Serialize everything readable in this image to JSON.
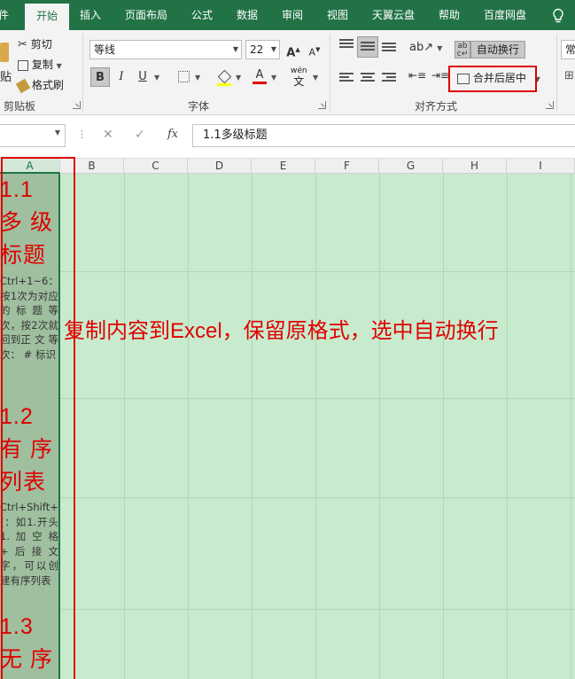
{
  "ribbon_tabs": [
    "件",
    "开始",
    "插入",
    "页面布局",
    "公式",
    "数据",
    "审阅",
    "视图",
    "天翼云盘",
    "帮助",
    "百度网盘"
  ],
  "clipboard": {
    "paste_label": "贴",
    "cut_label": "剪切",
    "copy_label": "复制",
    "format_painter_label": "格式刷",
    "group_label": "剪贴板"
  },
  "font": {
    "name": "等线",
    "size": "22",
    "grow_label": "A",
    "shrink_label": "A",
    "bold_label": "B",
    "italic_label": "I",
    "underline_label": "U",
    "font_color": "A",
    "phonetic_label": "wén",
    "group_label": "字体",
    "accent_red": "#e00000",
    "highlight_yellow": "#ffff00"
  },
  "alignment": {
    "wrap_text_label": "自动换行",
    "merge_center_label": "合并后居中",
    "group_label": "对齐方式"
  },
  "number": {
    "format_label": "常"
  },
  "formula_bar": {
    "cancel_symbol": "✕",
    "enter_symbol": "✓",
    "fx_label": "fx",
    "content": "1.1多级标题"
  },
  "columns": [
    "A",
    "B",
    "C",
    "D",
    "E",
    "F",
    "G",
    "H",
    "I"
  ],
  "cells": {
    "h1_line1": "1.1",
    "h1_line2": "多 级",
    "h1_line3": "标题",
    "note1": "Ctrl+1~6：按1次为对应的标题等次，按2次就回到正 文 等 次： # 标识",
    "h2_line1": "1.2",
    "h2_line2": "有 序",
    "h2_line3": "列表",
    "note2": "Ctrl+Shift+[：如1.开头1.加空格+后接文字，可以创建有序列表",
    "h3_line1": "1.3",
    "h3_line2": "无 序"
  },
  "annotation_text": "复制内容到Excel，保留原格式，选中自动换行"
}
